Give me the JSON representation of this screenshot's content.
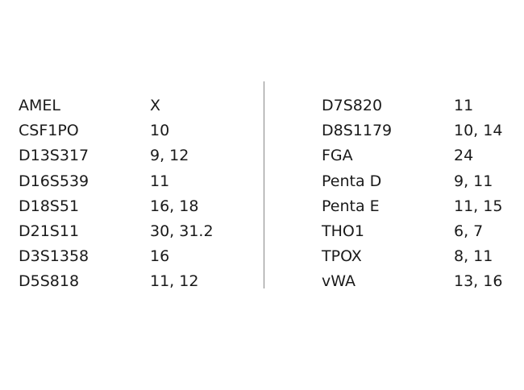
{
  "left_column": [
    {
      "locus": "AMEL",
      "alleles": "X"
    },
    {
      "locus": "CSF1PO",
      "alleles": "10"
    },
    {
      "locus": "D13S317",
      "alleles": "9, 12"
    },
    {
      "locus": "D16S539",
      "alleles": "11"
    },
    {
      "locus": "D18S51",
      "alleles": "16, 18"
    },
    {
      "locus": "D21S11",
      "alleles": "30, 31.2"
    },
    {
      "locus": "D3S1358",
      "alleles": "16"
    },
    {
      "locus": "D5S818",
      "alleles": "11, 12"
    }
  ],
  "right_column": [
    {
      "locus": "D7S820",
      "alleles": "11"
    },
    {
      "locus": "D8S1179",
      "alleles": "10, 14"
    },
    {
      "locus": "FGA",
      "alleles": "24"
    },
    {
      "locus": "Penta D",
      "alleles": "9, 11"
    },
    {
      "locus": "Penta E",
      "alleles": "11, 15"
    },
    {
      "locus": "THO1",
      "alleles": "6, 7"
    },
    {
      "locus": "TPOX",
      "alleles": "8, 11"
    },
    {
      "locus": "vWA",
      "alleles": "13, 16"
    }
  ],
  "colors": {
    "text": "#1a1a1a",
    "divider": "#888888",
    "background": "#ffffff"
  }
}
